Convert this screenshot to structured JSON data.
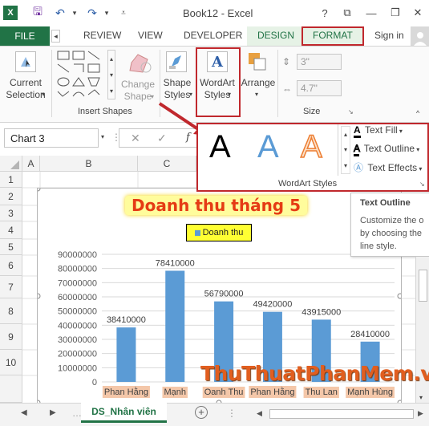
{
  "window": {
    "title": "Book12 - Excel",
    "help": "?",
    "restore": "⧉",
    "minimize": "—",
    "close": "✕"
  },
  "tabs": {
    "file": "FILE",
    "review": "REVIEW",
    "view": "VIEW",
    "developer": "DEVELOPER",
    "design": "DESIGN",
    "format": "FORMAT",
    "signin": "Sign in"
  },
  "ribbon": {
    "current_selection": [
      "Current",
      "Selection"
    ],
    "change_shape": [
      "Change",
      "Shape"
    ],
    "shape_styles": [
      "Shape",
      "Styles"
    ],
    "wordart_styles": [
      "WordArt",
      "Styles"
    ],
    "arrange": "Arrange",
    "insert_shapes_label": "Insert Shapes",
    "size_label": "Size",
    "height_value": "3\"",
    "width_value": "4.7\""
  },
  "wordart_gallery": {
    "samples": [
      "A",
      "A",
      "A"
    ],
    "text_fill": "Text Fill",
    "text_outline": "Text Outline",
    "text_effects": "Text Effects",
    "group_label": "WordArt Styles"
  },
  "tooltip": {
    "title": "Text Outline",
    "lines": [
      "Customize the o",
      "by choosing the",
      "line style."
    ]
  },
  "namebox": "Chart 3",
  "columns": [
    "A",
    "B",
    "C"
  ],
  "rows": [
    "1",
    "2",
    "3",
    "4",
    "5",
    "6",
    "7",
    "8",
    "9",
    "10"
  ],
  "chart_data": {
    "type": "bar",
    "title": "Doanh thu tháng 5",
    "legend": "Doanh thu",
    "categories": [
      "Phan Hằng",
      "Mạnh",
      "Oanh Thu",
      "Phan Hằng",
      "Thu Lan",
      "Mạnh Hùng"
    ],
    "series": [
      {
        "name": "Doanh thu",
        "values": [
          38410000,
          78410000,
          56790000,
          49420000,
          43915000,
          28410000
        ]
      }
    ],
    "y_ticks": [
      "0",
      "10000000",
      "20000000",
      "30000000",
      "40000000",
      "50000000",
      "60000000",
      "70000000",
      "80000000",
      "90000000"
    ],
    "ylim": [
      0,
      90000000
    ],
    "bar_color": "#5b9bd5"
  },
  "sheet_tab": "DS_Nhân viên",
  "watermark": "ThuThuatPhanMem.vn"
}
